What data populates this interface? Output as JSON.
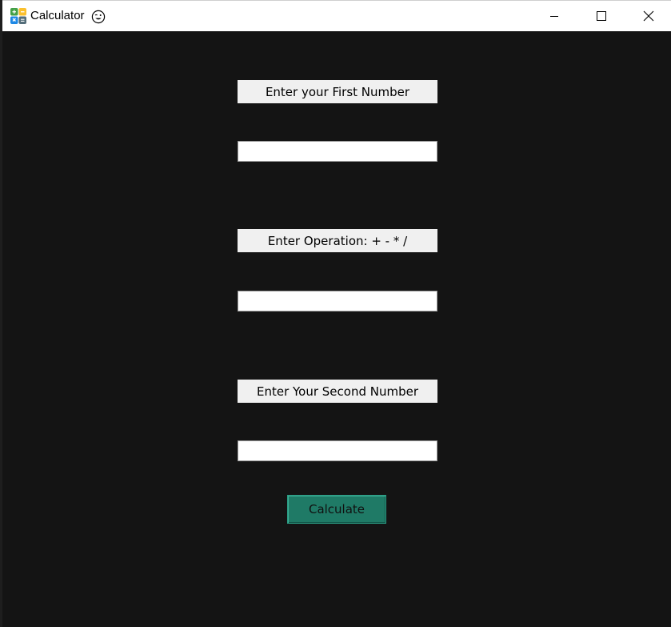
{
  "window": {
    "title": "Calculator",
    "icon": "calculator-app-icon",
    "title_emoji_icon": "winking-smiley-icon"
  },
  "controls": {
    "minimize": "minimize-icon",
    "maximize": "maximize-icon",
    "close": "close-icon"
  },
  "form": {
    "first_label": "Enter your First Number",
    "first_value": "",
    "operation_label": "Enter Operation: + - * /",
    "operation_value": "",
    "second_label": "Enter Your Second Number",
    "second_value": "",
    "calculate_label": "Calculate"
  },
  "colors": {
    "background": "#141414",
    "label_bg": "#f0f0f0",
    "button_bg": "#1f7a66"
  }
}
